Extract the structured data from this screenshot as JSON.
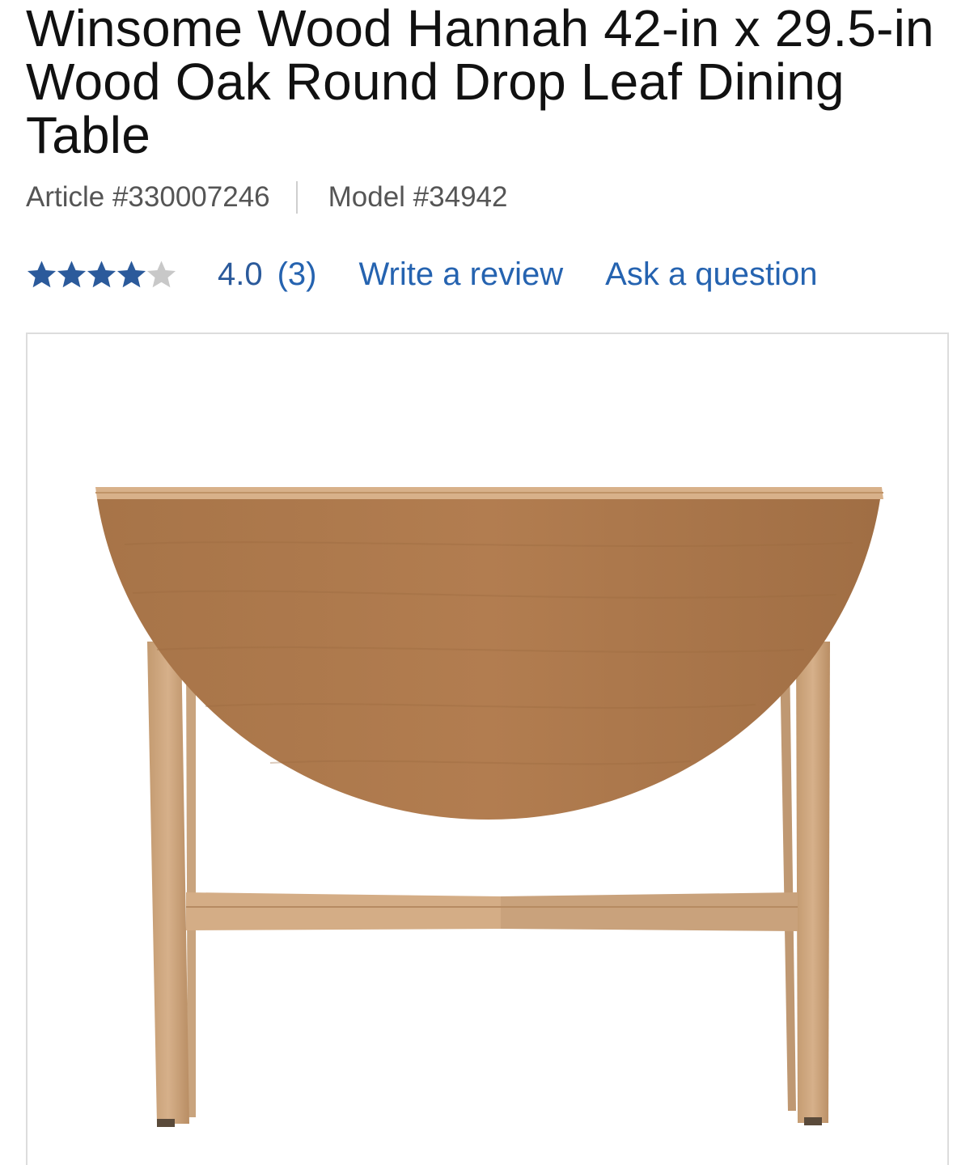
{
  "product": {
    "title": "Winsome Wood Hannah 42-in x 29.5-in Wood Oak Round Drop Leaf Dining Table",
    "article": "Article #330007246",
    "model": "Model #34942"
  },
  "rating": {
    "stars": 4,
    "max_stars": 5,
    "value_label": "4.0",
    "count_label": "(3)"
  },
  "actions": {
    "write_review": "Write a review",
    "ask_question": "Ask a question"
  },
  "colors": {
    "star_filled": "#2b5a9b",
    "star_empty": "#c8c8c8",
    "link": "#2563b0"
  },
  "image": {
    "subject": "drop-leaf-table-photo"
  }
}
